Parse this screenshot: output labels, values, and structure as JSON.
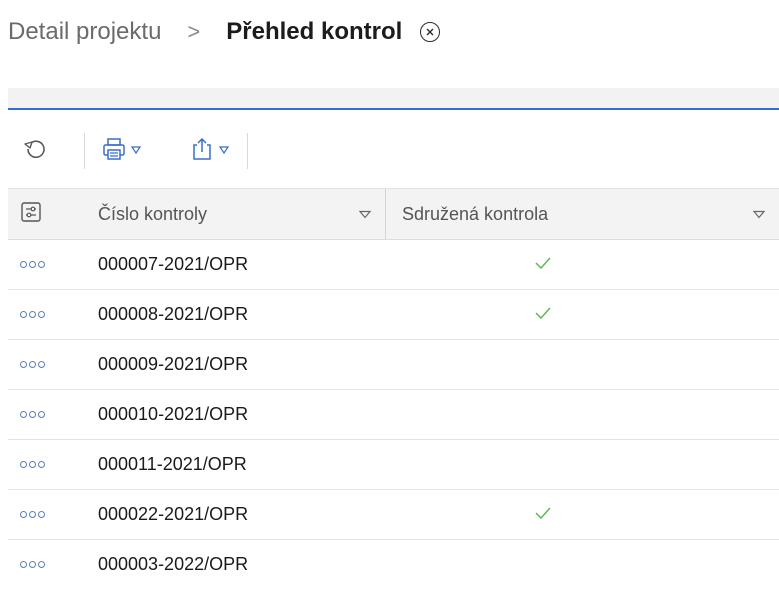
{
  "breadcrumb": {
    "parent": "Detail projektu",
    "separator": ">",
    "current": "Přehled kontrol"
  },
  "toolbar": {
    "icons": [
      "refresh-icon",
      "print-icon",
      "export-icon"
    ]
  },
  "table": {
    "columns": [
      "Číslo kontroly",
      "Sdružená kontrola"
    ],
    "rows": [
      {
        "number": "000007-2021/OPR",
        "combined": true
      },
      {
        "number": "000008-2021/OPR",
        "combined": true
      },
      {
        "number": "000009-2021/OPR",
        "combined": false
      },
      {
        "number": "000010-2021/OPR",
        "combined": false
      },
      {
        "number": "000011-2021/OPR",
        "combined": false
      },
      {
        "number": "000022-2021/OPR",
        "combined": true
      },
      {
        "number": "000003-2022/OPR",
        "combined": false
      }
    ]
  },
  "colors": {
    "accent": "#2f6fcf",
    "check": "#5cb85c",
    "row_menu": "#5a7fc0"
  }
}
